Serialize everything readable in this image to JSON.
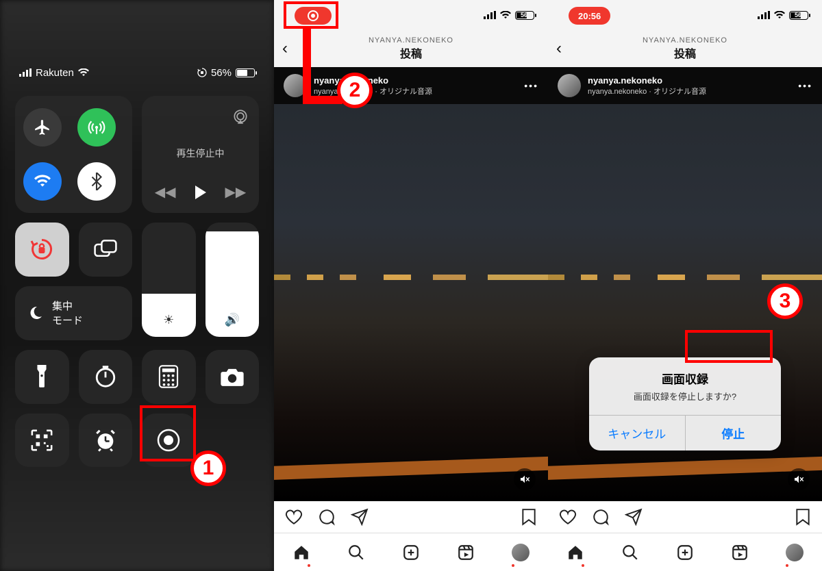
{
  "annotations": {
    "badge1": "1",
    "badge2": "2",
    "badge3": "3"
  },
  "cc": {
    "carrier": "Rakuten",
    "battery_text": "56%",
    "media_status": "再生停止中",
    "focus_label": "集中\nモード",
    "brightness_pct": 38,
    "volume_pct": 92
  },
  "ig": {
    "nav_user": "NYANYA.NEKONEKO",
    "nav_title": "投稿",
    "post_user": "nyanya.nekoneko",
    "post_sub": "nyanya.nekoneko · オリジナル音源"
  },
  "status3": {
    "time": "20:56",
    "batt": "56"
  },
  "status2": {
    "batt": "56"
  },
  "alert": {
    "title": "画面収録",
    "message": "画面収録を停止しますか?",
    "cancel": "キャンセル",
    "stop": "停止"
  }
}
